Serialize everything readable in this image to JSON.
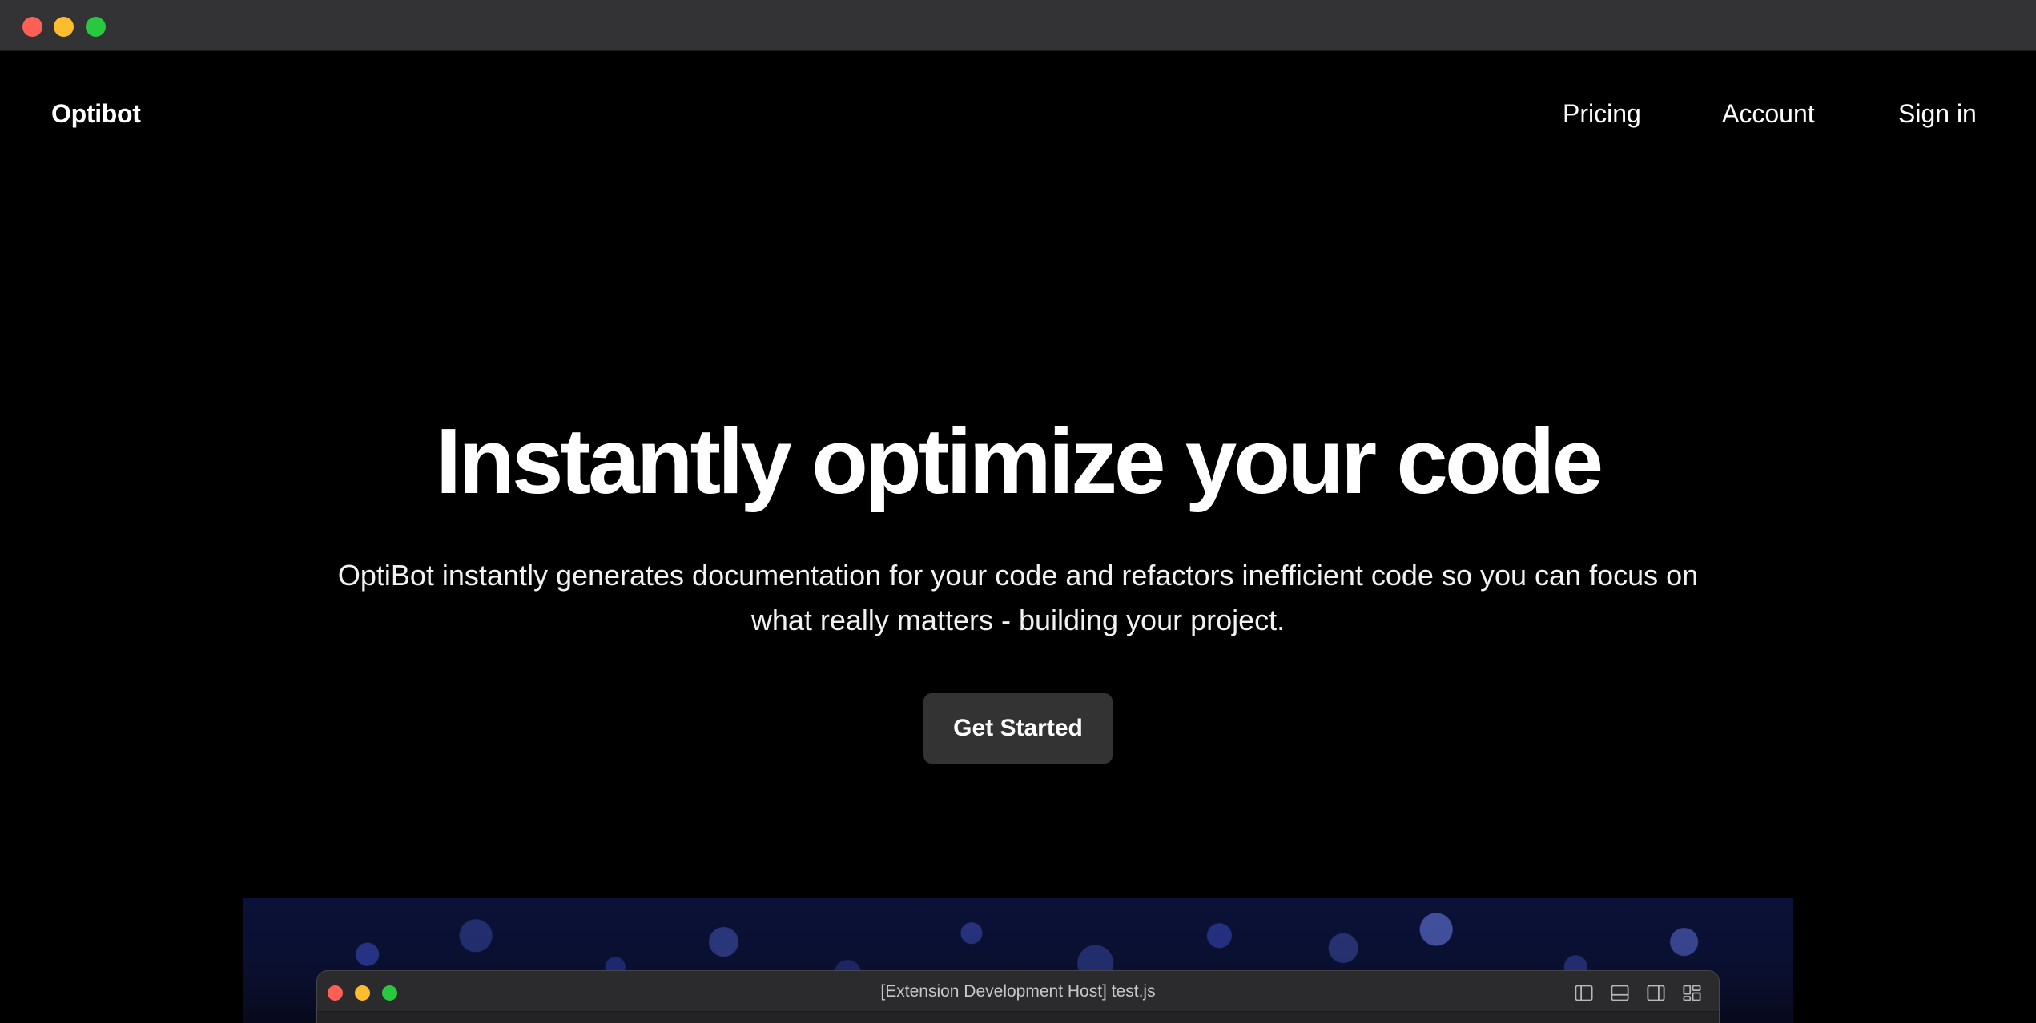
{
  "nav": {
    "brand": "Optibot",
    "links": [
      "Pricing",
      "Account",
      "Sign in"
    ]
  },
  "hero": {
    "title": "Instantly optimize your code",
    "subtitle_line1": "OptiBot instantly generates documentation for your code and refactors inefficient code so you can focus on",
    "subtitle_line2": "what really matters - building your project.",
    "cta_label": "Get Started"
  },
  "preview": {
    "window_title": "[Extension Development Host] test.js",
    "icons": [
      "toggle-primary-sidebar-icon",
      "toggle-panel-icon",
      "toggle-secondary-sidebar-icon",
      "customize-layout-icon"
    ]
  },
  "colors": {
    "background": "#000000",
    "chrome": "#333335",
    "button": "#333333",
    "text": "#ffffff"
  }
}
